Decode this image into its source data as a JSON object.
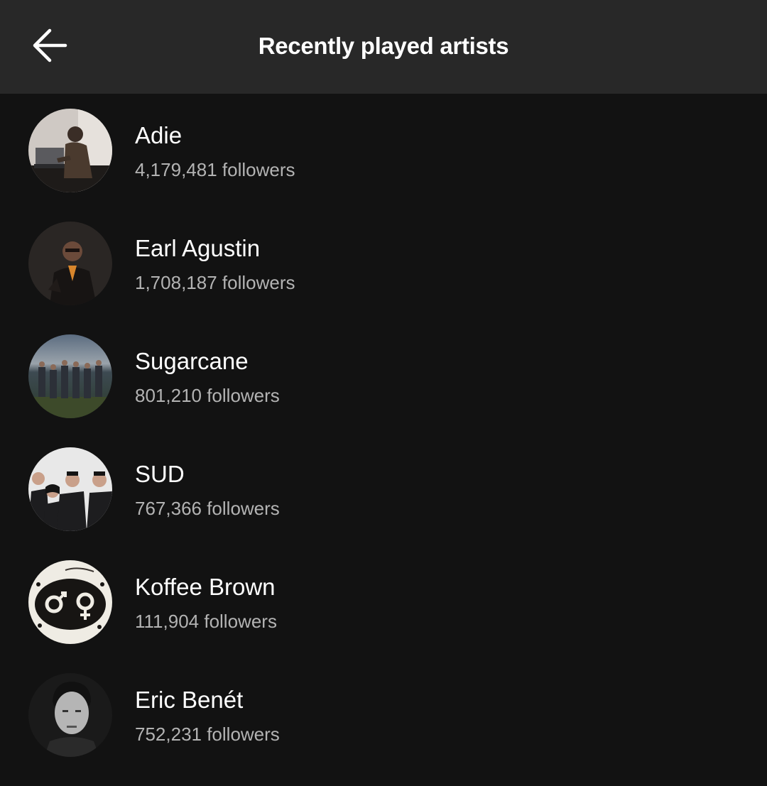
{
  "header": {
    "title": "Recently played artists",
    "back_icon": "arrow-left-icon"
  },
  "artists": [
    {
      "name": "Adie",
      "followers": "4,179,481 followers"
    },
    {
      "name": "Earl Agustin",
      "followers": "1,708,187 followers"
    },
    {
      "name": "Sugarcane",
      "followers": "801,210 followers"
    },
    {
      "name": "SUD",
      "followers": "767,366 followers"
    },
    {
      "name": "Koffee Brown",
      "followers": "111,904 followers"
    },
    {
      "name": "Eric Benét",
      "followers": "752,231 followers"
    }
  ],
  "colors": {
    "background": "#121212",
    "header": "#282828",
    "primary_text": "#ffffff",
    "secondary_text": "#b3b3b3"
  }
}
